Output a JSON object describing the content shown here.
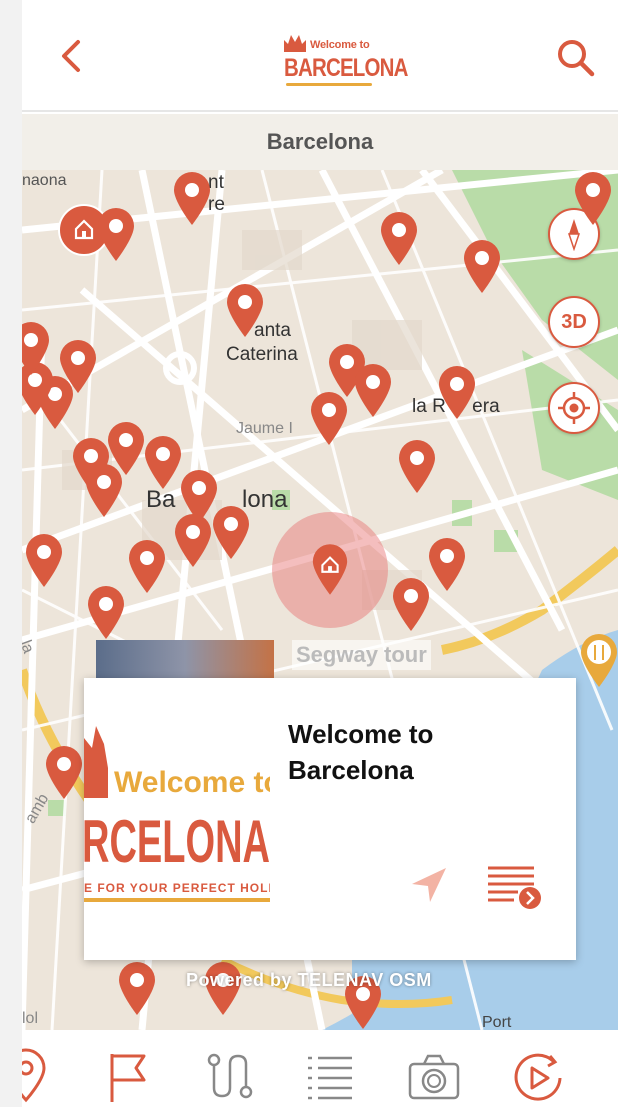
{
  "header": {
    "back_icon": "chevron-left-icon",
    "search_icon": "search-icon",
    "logo": {
      "small_text": "Welcome to",
      "big_text": "BARCELONA"
    }
  },
  "city_bar": {
    "title": "Barcelona"
  },
  "map": {
    "labels": {
      "naona": "naona",
      "nt": "nt",
      "re": "re",
      "santa": "anta",
      "caterina": "Caterina",
      "la_ribera": "la R     era",
      "jaume": "Jaume I",
      "barcelona": "Ba          lona",
      "la_left": "la",
      "amb": "amb",
      "lol": "lol",
      "port": "Port"
    },
    "controls": {
      "compass_icon": "compass-icon",
      "three_d_label": "3D",
      "locate_icon": "crosshair-icon"
    },
    "preview_label": "Segway tour",
    "attribution": "Powered by TELENAV   OSM"
  },
  "info_card": {
    "title": "Welcome to Barcelona",
    "image_text_top": "Welcome to",
    "image_text_big": "RCELONA",
    "image_text_tag": "E FOR YOUR PERFECT HOLID",
    "navigate_icon": "navigation-arrow-icon",
    "details_icon": "list-details-icon"
  },
  "bottom_nav": {
    "icons": [
      "location-pin-icon",
      "flag-icon",
      "route-icon",
      "list-icon",
      "camera-icon",
      "play-icon"
    ]
  },
  "colors": {
    "accent": "#d95a3f",
    "map_bg": "#ede5da",
    "park": "#b9dca8",
    "water": "#a8cdea",
    "road": "#ffffff",
    "major_road": "#f2c95c"
  }
}
